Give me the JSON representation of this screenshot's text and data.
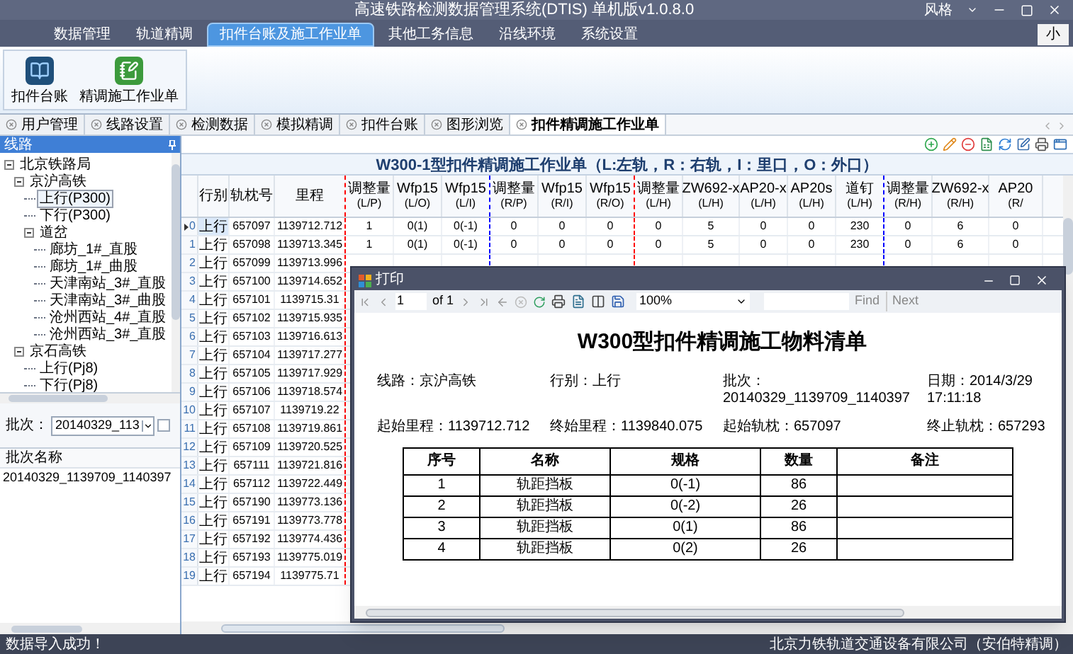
{
  "window": {
    "title": "高速铁路检测数据管理系统(DTIS) 单机版v1.0.8.0",
    "style_menu": "风格"
  },
  "menu_tabs": [
    {
      "label": "数据管理",
      "selected": false
    },
    {
      "label": "轨道精调",
      "selected": false
    },
    {
      "label": "扣件台账及施工作业单",
      "selected": true
    },
    {
      "label": "其他工务信息",
      "selected": false
    },
    {
      "label": "沿线环境",
      "selected": false
    },
    {
      "label": "系统设置",
      "selected": false
    }
  ],
  "size_button": "小",
  "ribbon": {
    "buttons": [
      {
        "label": "扣件台账",
        "kind": "ledger"
      },
      {
        "label": "精调施工作业单",
        "kind": "worksheet"
      }
    ]
  },
  "doc_tabs": [
    {
      "label": "用户管理",
      "selected": false
    },
    {
      "label": "线路设置",
      "selected": false
    },
    {
      "label": "检测数据",
      "selected": false
    },
    {
      "label": "模拟精调",
      "selected": false
    },
    {
      "label": "扣件台账",
      "selected": false
    },
    {
      "label": "图形浏览",
      "selected": false
    },
    {
      "label": "扣件精调施工作业单",
      "selected": true
    }
  ],
  "sidebar": {
    "title": "线路",
    "tree": [
      {
        "label": "北京铁路局",
        "expanded": true,
        "selected": false,
        "children": [
          {
            "label": "京沪高铁",
            "expanded": true,
            "selected": false,
            "children": [
              {
                "label": "上行(P300)",
                "selected": true
              },
              {
                "label": "下行(P300)",
                "selected": false
              },
              {
                "label": "道岔",
                "expanded": true,
                "selected": false,
                "children": [
                  {
                    "label": "廊坊_1#_直股",
                    "selected": false
                  },
                  {
                    "label": "廊坊_1#_曲股",
                    "selected": false
                  },
                  {
                    "label": "天津南站_3#_直股",
                    "selected": false
                  },
                  {
                    "label": "天津南站_3#_曲股",
                    "selected": false
                  },
                  {
                    "label": "沧州西站_4#_直股",
                    "selected": false
                  },
                  {
                    "label": "沧州西站_3#_直股",
                    "selected": false
                  }
                ]
              }
            ]
          },
          {
            "label": "京石高铁",
            "expanded": true,
            "selected": false,
            "children": [
              {
                "label": "上行(Pj8)",
                "selected": false
              },
              {
                "label": "下行(Pj8)",
                "selected": false
              }
            ]
          }
        ]
      }
    ],
    "batch_label": "批次：",
    "batch_value": "20140329_113",
    "batch_checked": false,
    "list_header": "批次名称",
    "list_items": [
      "20140329_1139709_1140397"
    ]
  },
  "sheet": {
    "title": "W300-1型扣件精调施工作业单（L:左轨，R：右轨，I：里口，O：外口）",
    "columns": [
      {
        "label": "行别"
      },
      {
        "label": "轨枕号"
      },
      {
        "label": "里程",
        "color": "#ff0000"
      },
      {
        "label": "调整量",
        "sub": "(L/P)"
      },
      {
        "label": "Wfp15",
        "sub": "(L/O)"
      },
      {
        "label": "Wfp15",
        "sub": "(L/I)",
        "color": "#0000ff"
      },
      {
        "label": "调整量",
        "sub": "(R/P)"
      },
      {
        "label": "Wfp15",
        "sub": "(R/I)"
      },
      {
        "label": "Wfp15",
        "sub": "(R/O)",
        "color": "#ff0000"
      },
      {
        "label": "调整量",
        "sub": "(L/H)"
      },
      {
        "label": "ZW692-x",
        "sub": "(L/H)"
      },
      {
        "label": "AP20-x",
        "sub": "(L/H)"
      },
      {
        "label": "AP20s",
        "sub": "(L/H)"
      },
      {
        "label": "道钉",
        "sub": "(L/H)",
        "color": "#0000ff"
      },
      {
        "label": "调整量",
        "sub": "(R/H)"
      },
      {
        "label": "ZW692-x",
        "sub": "(R/H)"
      },
      {
        "label": "AP20",
        "sub": "(R/"
      }
    ],
    "rows": [
      {
        "index": "0",
        "current": true,
        "cells": [
          "上行",
          "657097",
          "1139712.712",
          "1",
          "0(1)",
          "0(-1)",
          "0",
          "0",
          "0",
          "0",
          "5",
          "0",
          "0",
          "230",
          "0",
          "6",
          "0"
        ]
      },
      {
        "index": "1",
        "current": false,
        "cells": [
          "上行",
          "657098",
          "1139713.345",
          "1",
          "0(1)",
          "0(-1)",
          "0",
          "0",
          "0",
          "0",
          "5",
          "0",
          "0",
          "230",
          "0",
          "6",
          "0"
        ]
      },
      {
        "index": "2",
        "current": false,
        "cells": [
          "上行",
          "657099",
          "1139713.996"
        ]
      },
      {
        "index": "3",
        "current": false,
        "cells": [
          "上行",
          "657100",
          "1139714.652"
        ]
      },
      {
        "index": "4",
        "current": false,
        "cells": [
          "上行",
          "657101",
          "1139715.31"
        ]
      },
      {
        "index": "5",
        "current": false,
        "cells": [
          "上行",
          "657102",
          "1139715.935"
        ]
      },
      {
        "index": "6",
        "current": false,
        "cells": [
          "上行",
          "657103",
          "1139716.613"
        ]
      },
      {
        "index": "7",
        "current": false,
        "cells": [
          "上行",
          "657104",
          "1139717.277"
        ]
      },
      {
        "index": "8",
        "current": false,
        "cells": [
          "上行",
          "657105",
          "1139717.929"
        ]
      },
      {
        "index": "9",
        "current": false,
        "cells": [
          "上行",
          "657106",
          "1139718.574"
        ]
      },
      {
        "index": "10",
        "current": false,
        "cells": [
          "上行",
          "657107",
          "1139719.22"
        ]
      },
      {
        "index": "11",
        "current": false,
        "cells": [
          "上行",
          "657108",
          "1139719.861"
        ]
      },
      {
        "index": "12",
        "current": false,
        "cells": [
          "上行",
          "657109",
          "1139720.525"
        ]
      },
      {
        "index": "13",
        "current": false,
        "cells": [
          "上行",
          "657111",
          "1139721.816"
        ]
      },
      {
        "index": "14",
        "current": false,
        "cells": [
          "上行",
          "657112",
          "1139722.449"
        ]
      },
      {
        "index": "15",
        "current": false,
        "cells": [
          "上行",
          "657190",
          "1139773.136"
        ]
      },
      {
        "index": "16",
        "current": false,
        "cells": [
          "上行",
          "657191",
          "1139773.778"
        ]
      },
      {
        "index": "17",
        "current": false,
        "cells": [
          "上行",
          "657192",
          "1139774.436"
        ]
      },
      {
        "index": "18",
        "current": false,
        "cells": [
          "上行",
          "657193",
          "1139775.019"
        ]
      },
      {
        "index": "19",
        "current": false,
        "cells": [
          "上行",
          "657194",
          "1139775.71"
        ]
      }
    ]
  },
  "print_dialog": {
    "title": "打印",
    "page": "1",
    "page_of": "of 1",
    "zoom": "100%",
    "find": "Find",
    "next": "Next",
    "report": {
      "title": "W300型扣件精调施工物料清单",
      "fields": [
        {
          "label": "线路：",
          "value": "京沪高铁"
        },
        {
          "label": "行别：",
          "value": "上行"
        },
        {
          "label": "批次：",
          "value": "20140329_1139709_1140397"
        },
        {
          "label": "日期：",
          "value": "2014/3/29 17:11:18"
        },
        {
          "label": "起始里程：",
          "value": "1139712.712"
        },
        {
          "label": "终始里程：",
          "value": "1139840.075"
        },
        {
          "label": "起始轨枕：",
          "value": "657097"
        },
        {
          "label": "终止轨枕：",
          "value": "657293"
        }
      ],
      "columns": [
        "序号",
        "名称",
        "规格",
        "数量",
        "备注"
      ],
      "rows": [
        [
          "1",
          "轨距挡板",
          "0(-1)",
          "86"
        ],
        [
          "2",
          "轨距挡板",
          "0(-2)",
          "26"
        ],
        [
          "3",
          "轨距挡板",
          "0(1)",
          "86"
        ],
        [
          "4",
          "轨距挡板",
          "0(2)",
          "26"
        ]
      ]
    }
  },
  "status_bar": {
    "message": "数据导入成功！",
    "company": "北京力铁轨道交通设备有限公司（安伯特精调）"
  }
}
